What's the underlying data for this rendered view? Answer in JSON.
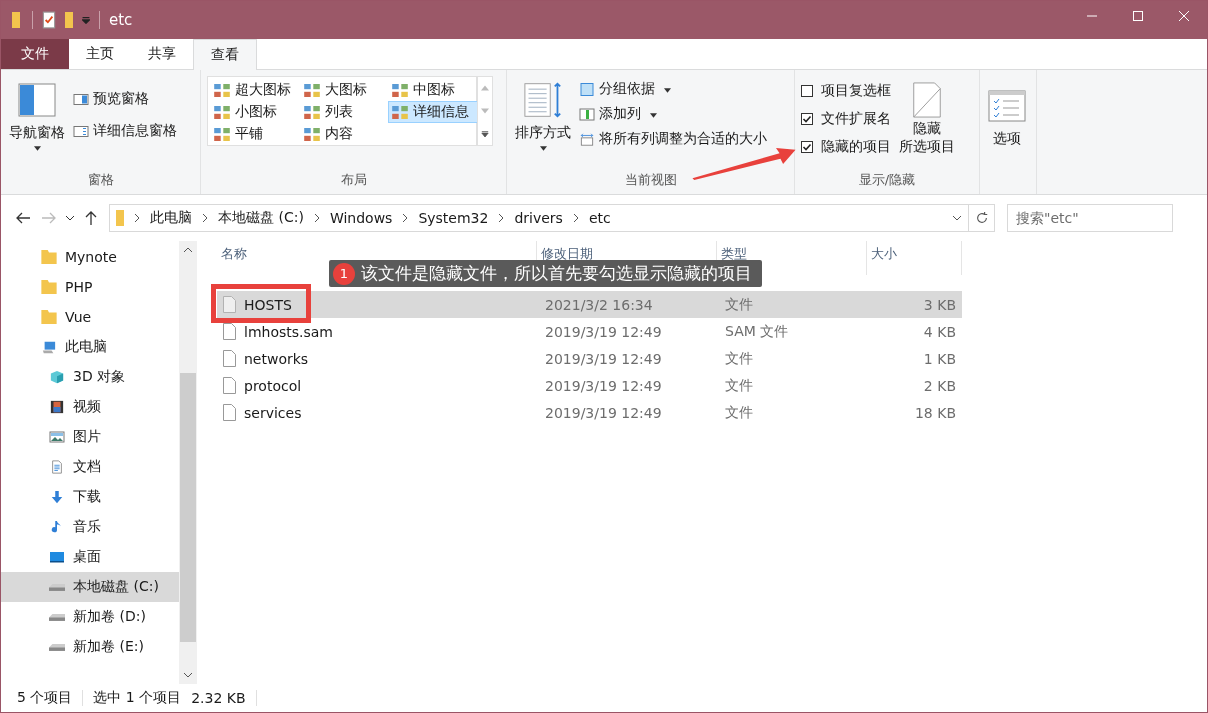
{
  "window": {
    "title": "etc"
  },
  "tabs": [
    {
      "label": "文件",
      "kind": "file",
      "selected": false
    },
    {
      "label": "主页",
      "kind": "tab",
      "selected": false
    },
    {
      "label": "共享",
      "kind": "tab",
      "selected": false
    },
    {
      "label": "查看",
      "kind": "tab",
      "selected": true
    }
  ],
  "ribbon": {
    "panes": {
      "label": "窗格",
      "nav": "导航窗格",
      "preview": "预览窗格",
      "details": "详细信息窗格"
    },
    "layout": {
      "label": "布局",
      "items": [
        {
          "label": "超大图标",
          "selected": false
        },
        {
          "label": "大图标",
          "selected": false
        },
        {
          "label": "中图标",
          "selected": false
        },
        {
          "label": "小图标",
          "selected": false
        },
        {
          "label": "列表",
          "selected": false
        },
        {
          "label": "详细信息",
          "selected": true
        },
        {
          "label": "平铺",
          "selected": false
        },
        {
          "label": "内容",
          "selected": false
        }
      ]
    },
    "current_view": {
      "label": "当前视图",
      "sort": "排序方式",
      "group": "分组依据",
      "add_column": "添加列",
      "fit_columns": "将所有列调整为合适的大小"
    },
    "show_hide": {
      "label": "显示/隐藏",
      "options": [
        {
          "label": "项目复选框",
          "checked": false
        },
        {
          "label": "文件扩展名",
          "checked": true
        },
        {
          "label": "隐藏的项目",
          "checked": true
        }
      ],
      "hide_selected": [
        "隐藏",
        "所选项目"
      ]
    },
    "options": "选项"
  },
  "address_bar": {
    "path": [
      "此电脑",
      "本地磁盘 (C:)",
      "Windows",
      "System32",
      "drivers",
      "etc"
    ],
    "search_placeholder": "搜索\"etc\""
  },
  "sidebar": {
    "items": [
      {
        "label": "Mynote",
        "kind": "folder",
        "selected": false
      },
      {
        "label": "PHP",
        "kind": "folder",
        "selected": false
      },
      {
        "label": "Vue",
        "kind": "folder",
        "selected": false
      },
      {
        "label": "此电脑",
        "kind": "pc",
        "selected": false,
        "children": [
          {
            "label": "3D 对象",
            "kind": "cube",
            "selected": false
          },
          {
            "label": "视频",
            "kind": "video",
            "selected": false
          },
          {
            "label": "图片",
            "kind": "image",
            "selected": false
          },
          {
            "label": "文档",
            "kind": "doc",
            "selected": false
          },
          {
            "label": "下载",
            "kind": "download",
            "selected": false
          },
          {
            "label": "音乐",
            "kind": "music",
            "selected": false
          },
          {
            "label": "桌面",
            "kind": "desktop",
            "selected": false
          },
          {
            "label": "本地磁盘 (C:)",
            "kind": "drive",
            "selected": true
          },
          {
            "label": "新加卷 (D:)",
            "kind": "drive",
            "selected": false
          },
          {
            "label": "新加卷 (E:)",
            "kind": "drive",
            "selected": false
          }
        ]
      }
    ]
  },
  "file_list": {
    "columns": [
      "名称",
      "修改日期",
      "类型",
      "大小"
    ],
    "rows": [
      {
        "name": "HOSTS",
        "date": "2021/3/2 16:34",
        "type": "文件",
        "size": "3 KB",
        "selected": true,
        "hidden": true
      },
      {
        "name": "lmhosts.sam",
        "date": "2019/3/19 12:49",
        "type": "SAM 文件",
        "size": "4 KB",
        "selected": false,
        "hidden": false
      },
      {
        "name": "networks",
        "date": "2019/3/19 12:49",
        "type": "文件",
        "size": "1 KB",
        "selected": false,
        "hidden": false
      },
      {
        "name": "protocol",
        "date": "2019/3/19 12:49",
        "type": "文件",
        "size": "2 KB",
        "selected": false,
        "hidden": false
      },
      {
        "name": "services",
        "date": "2019/3/19 12:49",
        "type": "文件",
        "size": "18 KB",
        "selected": false,
        "hidden": false
      }
    ]
  },
  "annotation": {
    "number": "1",
    "text": "该文件是隐藏文件，所以首先要勾选显示隐藏的项目"
  },
  "status_bar": {
    "count": "5 个项目",
    "selection": "选中 1 个项目",
    "size": "2.32 KB"
  }
}
